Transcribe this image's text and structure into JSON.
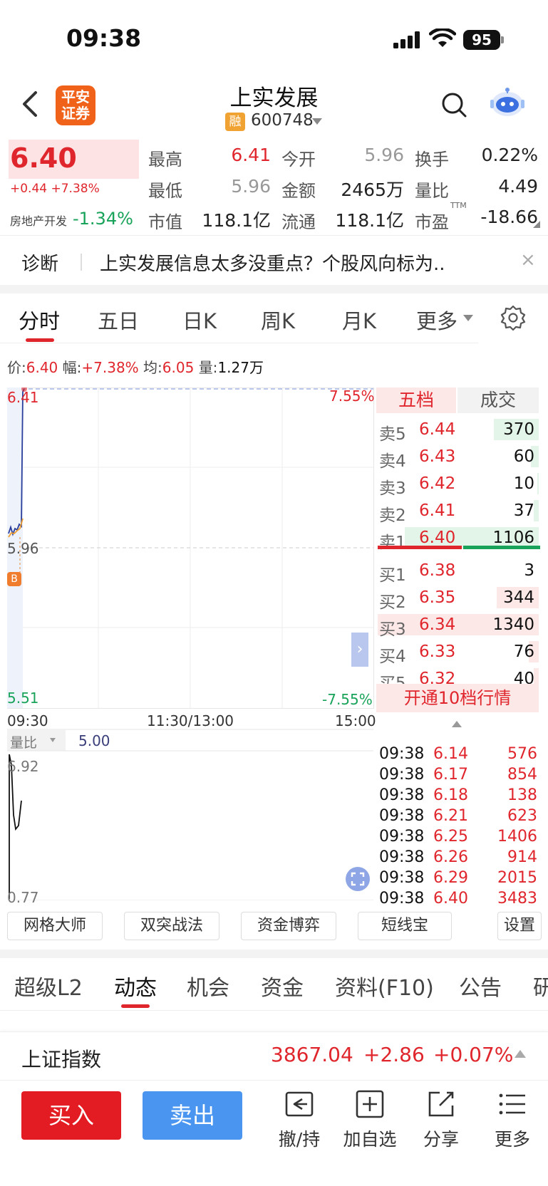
{
  "status": {
    "time": "09:38",
    "battery": "95"
  },
  "header": {
    "logo_line1": "平安",
    "logo_line2": "证券",
    "stock_name": "上实发展",
    "margin_badge": "融",
    "stock_code": "600748"
  },
  "quote": {
    "price": "6.40",
    "change": "+0.44 +7.38%",
    "sector_name": "房地产开发",
    "sector_change": "-1.34%",
    "stats": [
      {
        "label": "最高",
        "value": "6.41",
        "color": "red"
      },
      {
        "label": "今开",
        "value": "5.96",
        "color": "gray"
      },
      {
        "label": "换手",
        "value": "0.22%",
        "color": "black"
      },
      {
        "label": "最低",
        "value": "5.96",
        "color": "gray"
      },
      {
        "label": "金额",
        "value": "2465万",
        "color": "black"
      },
      {
        "label": "量比",
        "value": "4.49",
        "color": "black"
      },
      {
        "label": "市值",
        "value": "118.1亿",
        "color": "black"
      },
      {
        "label": "流通",
        "value": "118.1亿",
        "color": "black"
      },
      {
        "label": "市盈",
        "value": "-18.66",
        "color": "black",
        "sup": "TTM"
      }
    ]
  },
  "diagnosis": {
    "label": "诊断",
    "text": "上实发展信息太多没重点？个股风向标为..",
    "close": "×"
  },
  "chart_tabs": [
    "分时",
    "五日",
    "日K",
    "周K",
    "月K",
    "更多"
  ],
  "info_line": {
    "price_label": "价:",
    "price": "6.40",
    "amp_label": "幅:",
    "amp": "+7.38%",
    "avg_label": "均:",
    "avg": "6.05",
    "vol_label": "量:",
    "vol": "1.27万"
  },
  "chart": {
    "top_price": "6.41",
    "top_pct": "7.55%",
    "mid_price": "5.96",
    "bottom_price": "5.51",
    "bottom_pct": "-7.55%",
    "time_start": "09:30",
    "time_mid": "11:30/13:00",
    "time_end": "15:00",
    "marker": "B",
    "sub_label": "量比",
    "sub_value": "5.00",
    "sub_top": "6.92",
    "sub_bottom": "0.77"
  },
  "chart_data": {
    "type": "line",
    "x": [
      "09:30",
      "09:31",
      "09:32",
      "09:33",
      "09:34",
      "09:35"
    ],
    "series": [],
    "ylim": [
      5.51,
      6.41
    ]
  },
  "order_book": {
    "tab_left": "五档",
    "tab_right": "成交",
    "asks": [
      {
        "label": "卖5",
        "price": "6.44",
        "vol": "370",
        "bar": 0.28
      },
      {
        "label": "卖4",
        "price": "6.43",
        "vol": "60",
        "bar": 0.05
      },
      {
        "label": "卖3",
        "price": "6.42",
        "vol": "10",
        "bar": 0.01
      },
      {
        "label": "卖2",
        "price": "6.41",
        "vol": "37",
        "bar": 0.03
      },
      {
        "label": "卖1",
        "price": "6.40",
        "vol": "1106",
        "bar": 0.83
      }
    ],
    "bids": [
      {
        "label": "买1",
        "price": "6.38",
        "vol": "3",
        "bar": 0.0
      },
      {
        "label": "买2",
        "price": "6.35",
        "vol": "344",
        "bar": 0.26
      },
      {
        "label": "买3",
        "price": "6.34",
        "vol": "1340",
        "bar": 1.0
      },
      {
        "label": "买4",
        "price": "6.33",
        "vol": "76",
        "bar": 0.06
      },
      {
        "label": "买5",
        "price": "6.32",
        "vol": "40",
        "bar": 0.03
      }
    ],
    "open_level10": "开通10档行情",
    "ticks": [
      {
        "time": "09:38",
        "price": "6.14",
        "vol": "576"
      },
      {
        "time": "09:38",
        "price": "6.17",
        "vol": "854"
      },
      {
        "time": "09:38",
        "price": "6.18",
        "vol": "138"
      },
      {
        "time": "09:38",
        "price": "6.21",
        "vol": "623"
      },
      {
        "time": "09:38",
        "price": "6.25",
        "vol": "1406"
      },
      {
        "time": "09:38",
        "price": "6.26",
        "vol": "914"
      },
      {
        "time": "09:38",
        "price": "6.29",
        "vol": "2015"
      },
      {
        "time": "09:38",
        "price": "6.40",
        "vol": "3483"
      }
    ]
  },
  "tools": [
    "网格大师",
    "双突战法",
    "资金博弈",
    "短线宝",
    "设置"
  ],
  "bottom_tabs": [
    "超级L2",
    "动态",
    "机会",
    "资金",
    "资料(F10)",
    "公告",
    "研"
  ],
  "index": {
    "name": "上证指数",
    "value": "3867.04",
    "change": "+2.86",
    "pct": "+0.07%"
  },
  "actions": {
    "buy": "买入",
    "sell": "卖出",
    "cancel": "撤/持",
    "add_watch": "加自选",
    "share": "分享",
    "more": "更多"
  },
  "colors": {
    "up": "#e0262d",
    "down": "#19a35a",
    "accent": "#4a95f0",
    "brand": "#f0621a"
  }
}
